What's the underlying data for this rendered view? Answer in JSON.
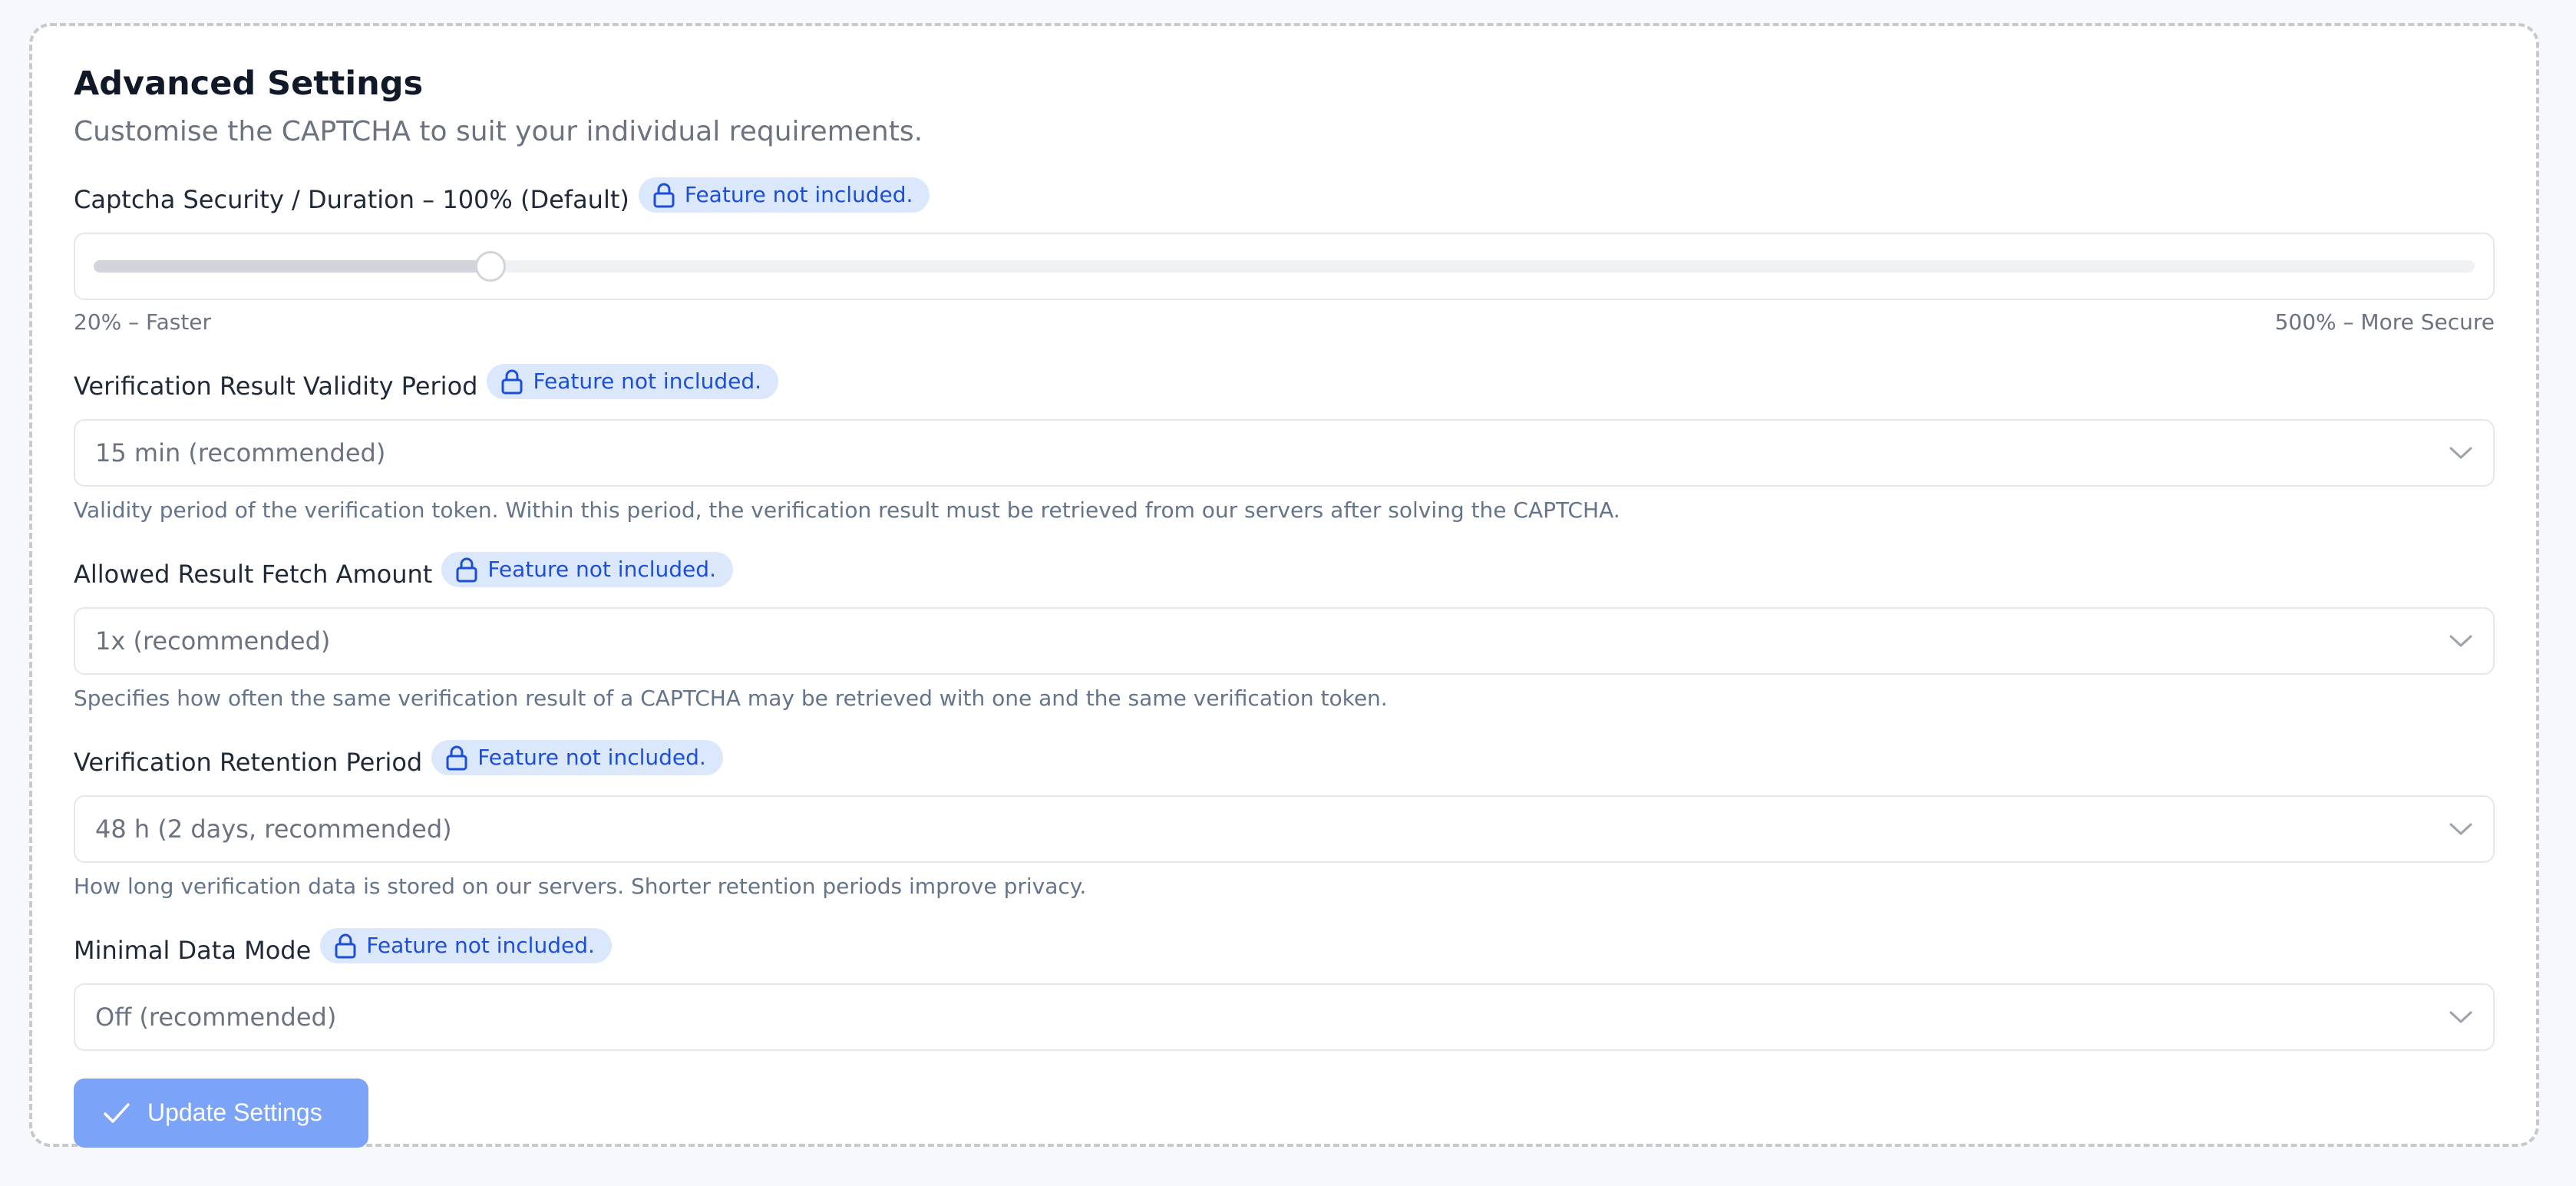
{
  "card": {
    "title": "Advanced Settings",
    "subtitle": "Customise the CAPTCHA to suit your individual requirements."
  },
  "badge_text": "Feature not included.",
  "security": {
    "label": "Captcha Security / Duration – 100% (Default)",
    "slider": {
      "min": 20,
      "max": 500,
      "value": 100
    },
    "min_label": "20% – Faster",
    "max_label": "500% – More Secure"
  },
  "validity": {
    "label": "Verification Result Validity Period",
    "value": "15 min (recommended)",
    "help": "Validity period of the verification token. Within this period, the verification result must be retrieved from our servers after solving the CAPTCHA."
  },
  "fetch": {
    "label": "Allowed Result Fetch Amount",
    "value": "1x (recommended)",
    "help": "Specifies how often the same verification result of a CAPTCHA may be retrieved with one and the same verification token."
  },
  "retention": {
    "label": "Verification Retention Period",
    "value": "48 h (2 days, recommended)",
    "help": "How long verification data is stored on our servers. Shorter retention periods improve privacy."
  },
  "minimal": {
    "label": "Minimal Data Mode",
    "value": "Off (recommended)"
  },
  "update_button": {
    "label": "Update Settings"
  },
  "colors": {
    "badge_bg": "#dbe8fb",
    "badge_text": "#1d4ed8",
    "button_bg": "#7ba3f7"
  }
}
